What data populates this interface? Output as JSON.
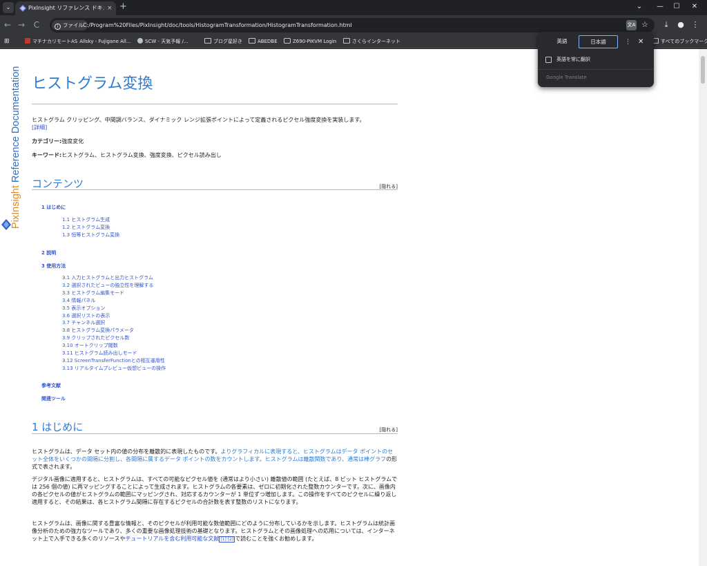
{
  "browser": {
    "tab": {
      "title": "PixInsight リファレンス ドキュメント | ",
      "close_glyph": "×"
    },
    "new_tab_glyph": "+",
    "window_controls": [
      "⌄",
      "—",
      "☐",
      "✕"
    ],
    "tab_search_glyph": "⌄",
    "nav": {
      "back": "←",
      "forward": "→",
      "reload": "C"
    },
    "address": {
      "chip_label": "ファイル",
      "url": "C:/Program%20Files/PixInsight/doc/tools/HistogramTransformation/HistogramTransformation.html"
    },
    "bookmarks": [
      {
        "label": "マチナカリモート"
      },
      {
        "label": "Allsky - Fujigane All..."
      },
      {
        "label": "SCW - 天気予報 /..."
      },
      {
        "label": "ブログ星好き"
      },
      {
        "label": "ABEDBE"
      },
      {
        "label": "Z690-PiKVM Login"
      },
      {
        "label": "さくらインターネット"
      },
      {
        "label": "すべてのブックマーク"
      }
    ],
    "bookmark_prefix_as": "AS"
  },
  "translate_popup": {
    "lang_source": "英語",
    "lang_target": "日本語",
    "menu_glyph": "⋮",
    "close_glyph": "✕",
    "always_translate": "英語を常に翻訳",
    "brand": "Google Translate"
  },
  "sidebar": {
    "brand_prefix": "PixInsight",
    "brand_suffix": " Reference Documentation"
  },
  "doc": {
    "title": "ヒストグラム変換",
    "intro": "ヒストグラム クリッピング、中間調バランス、ダイナミック レンジ拡張ポイントによって定義されるピクセル強度変換を実装します。",
    "details_link": "[詳細]",
    "category_label": "カテゴリー:",
    "category_value": "強度変化",
    "keywords_label": "キーワード:",
    "keywords_value": "ヒストグラム、ヒストグラム変換、強度変換、ピクセル読み出し",
    "contents_heading": "コンテンツ",
    "hide_label": "[隠れる]",
    "toc": {
      "s1": "1 はじめに",
      "s1_items": [
        "1.1 ヒストグラム生成",
        "1.2 ヒストグラム変換",
        "1.3 恒等ヒストグラム変換"
      ],
      "s2": "2 説明",
      "s3": "3 使用方法",
      "s3_items": [
        "3.1 入力ヒストグラムと出力ヒストグラム",
        "3.2 選択されたビューの独立性を理解する",
        "3.3 ヒストグラム編集モード",
        "3.4 情報パネル",
        "3.5 表示オプション",
        "3.6 選択リストの表示",
        "3.7 チャンネル選択",
        "3.8 ヒストグラム変換パラメータ",
        "3.9 クリップされたピクセル数",
        "3.10 オートクリップ閾数",
        "3.11 ヒストグラム読み出しモード",
        "3.12 ScreenTransferFunctionとの相互運用性",
        "3.13 リアルタイムプレビュー仮想ビューの操作"
      ],
      "refs": "参考文献",
      "related": "関連ツール"
    },
    "section1_heading": "1 はじめに",
    "para1_a": "ヒストグラムは、",
    "para1_b": "データ セット内の値の分布を離散的に表現したものです。",
    "para1_c": "よりグラフィカルに表現すると、ヒストグラムはデータ ポイントのセット全体をいくつかの間隔に分割し、各間隔に属するデータ ポイントの数をカウントします。ヒストグラムは離散関数であり、通常は棒グラフ",
    "para1_d": "の形式で表されます。",
    "para2": "デジタル画像に適用すると、ヒストグラムは、すべての可能なピクセル値を (通常はより小さい) 離散値の範囲 (たとえば、8 ビット ヒストグラムでは 256 個の値) に再マッピングすることによって生成されます。ヒストグラムの各要素は、ゼロに初期化された整数カウンターです。次に、画像内の各ピクセルの値がヒストグラムの範囲にマッピングされ、対応するカウンターが 1 単位ずつ増加します。この操作をすべてのピクセルに繰り返し適用すると、その結果は、各ヒストグラム間隔に存在するピクセルの合計数を表す整数のリストになります。",
    "para3_a": "ヒストグラムは、画像に関する豊富な情報と、そのピクセルが利用可能な数値範囲にどのように分布しているかを示します。ヒストグラムは統計画像分析のための強力なツールであり、多くの重要な画像処理技術の基礎となります。ヒストグラムとその画像処理への応用については、インターネット上で入手できる多くのリソースや",
    "para3_b": "チュートリアルを含む利用可能な文献",
    "para3_cite": "[1] [2]",
    "para3_c": "で読むことを強くお勧めします。"
  }
}
